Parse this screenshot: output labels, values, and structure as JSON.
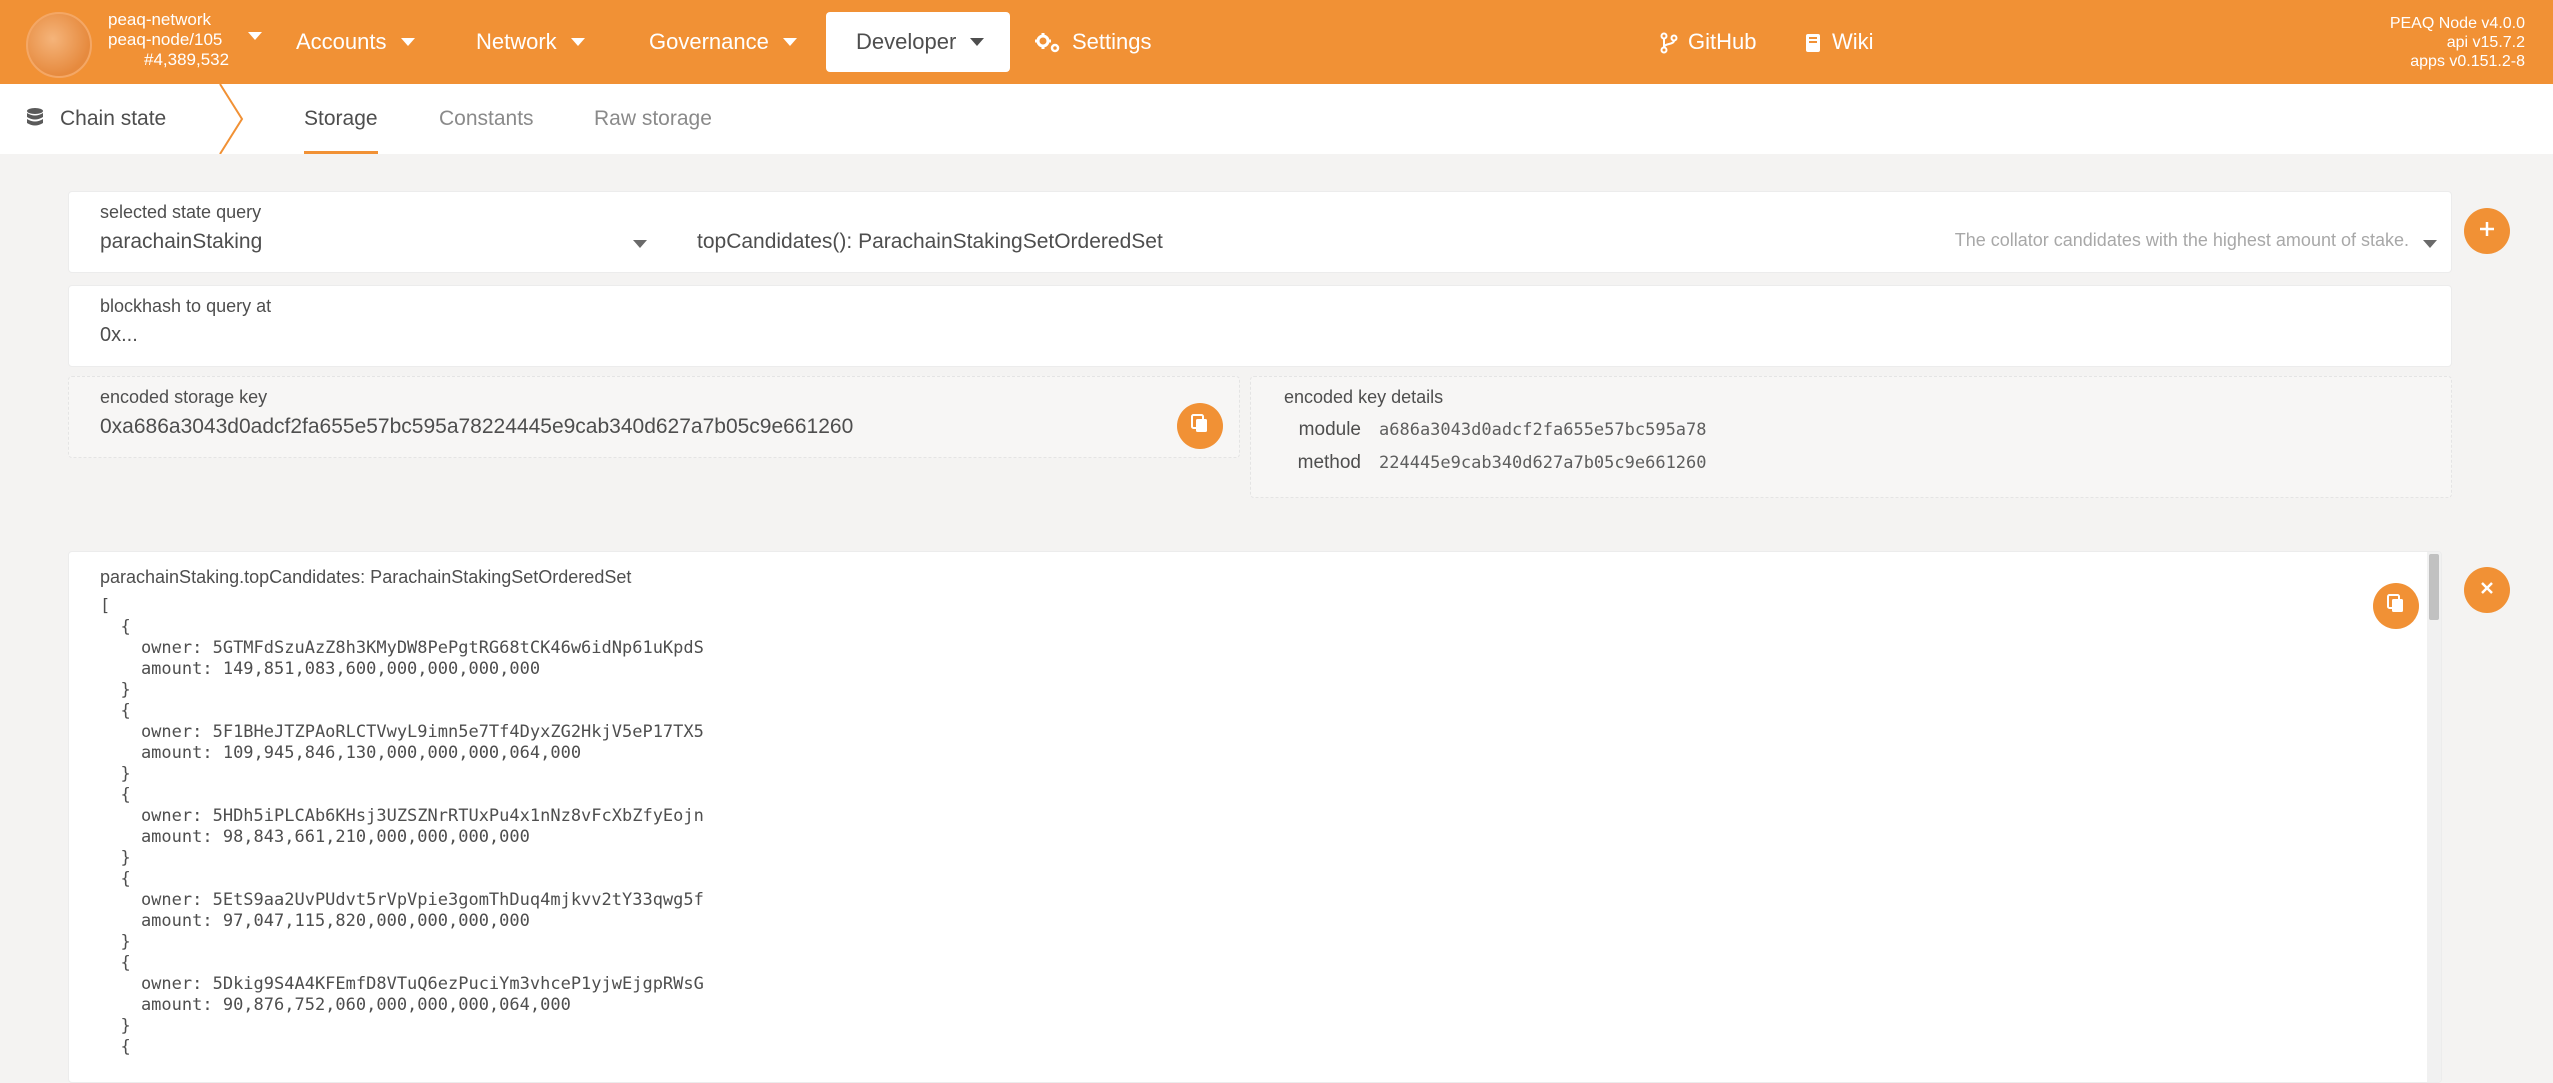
{
  "nav": {
    "chain_name": "peaq-network",
    "node": "peaq-node/105",
    "block": "#4,389,532",
    "items": [
      {
        "label": "Accounts"
      },
      {
        "label": "Network"
      },
      {
        "label": "Governance"
      },
      {
        "label": "Developer"
      },
      {
        "label": "Settings"
      },
      {
        "label": "GitHub"
      },
      {
        "label": "Wiki"
      }
    ],
    "version": [
      "PEAQ Node v4.0.0",
      "api v15.7.2",
      "apps v0.151.2-8"
    ]
  },
  "subnav": {
    "section": "Chain state",
    "tabs": [
      {
        "label": "Storage"
      },
      {
        "label": "Constants"
      },
      {
        "label": "Raw storage"
      }
    ]
  },
  "query": {
    "label": "selected state query",
    "module": "parachainStaking",
    "method": "topCandidates(): ParachainStakingSetOrderedSet",
    "hint": "The collator candidates with the highest amount of stake."
  },
  "blockhash": {
    "label": "blockhash to query at",
    "placeholder": "0x..."
  },
  "encoded_key": {
    "label": "encoded storage key",
    "value": "0xa686a3043d0adcf2fa655e57bc595a78224445e9cab340d627a7b05c9e661260"
  },
  "key_details": {
    "label": "encoded key details",
    "module_label": "module",
    "module_value": "a686a3043d0adcf2fa655e57bc595a78",
    "method_label": "method",
    "method_value": "224445e9cab340d627a7b05c9e661260"
  },
  "result": {
    "title": "parachainStaking.topCandidates: ParachainStakingSetOrderedSet",
    "entries": [
      {
        "owner": "5GTMFdSzuAzZ8h3KMyDW8PePgtRG68tCK46w6idNp61uKpdS",
        "amount": "149,851,083,600,000,000,000,000"
      },
      {
        "owner": "5F1BHeJTZPAoRLCTVwyL9imn5e7Tf4DyxZG2HkjV5eP17TX5",
        "amount": "109,945,846,130,000,000,000,064,000"
      },
      {
        "owner": "5HDh5iPLCAb6KHsj3UZSZNrRTUxPu4x1nNz8vFcXbZfyEojn",
        "amount": "98,843,661,210,000,000,000,000"
      },
      {
        "owner": "5EtS9aa2UvPUdvt5rVpVpie3gomThDuq4mjkvv2tY33qwg5f",
        "amount": "97,047,115,820,000,000,000,000"
      },
      {
        "owner": "5Dkig9S4A4KFEmfD8VTuQ6ezPuciYm3vhceP1yjwEjgpRWsG",
        "amount": "90,876,752,060,000,000,000,064,000"
      }
    ]
  },
  "colors": {
    "accent": "#f19135"
  }
}
